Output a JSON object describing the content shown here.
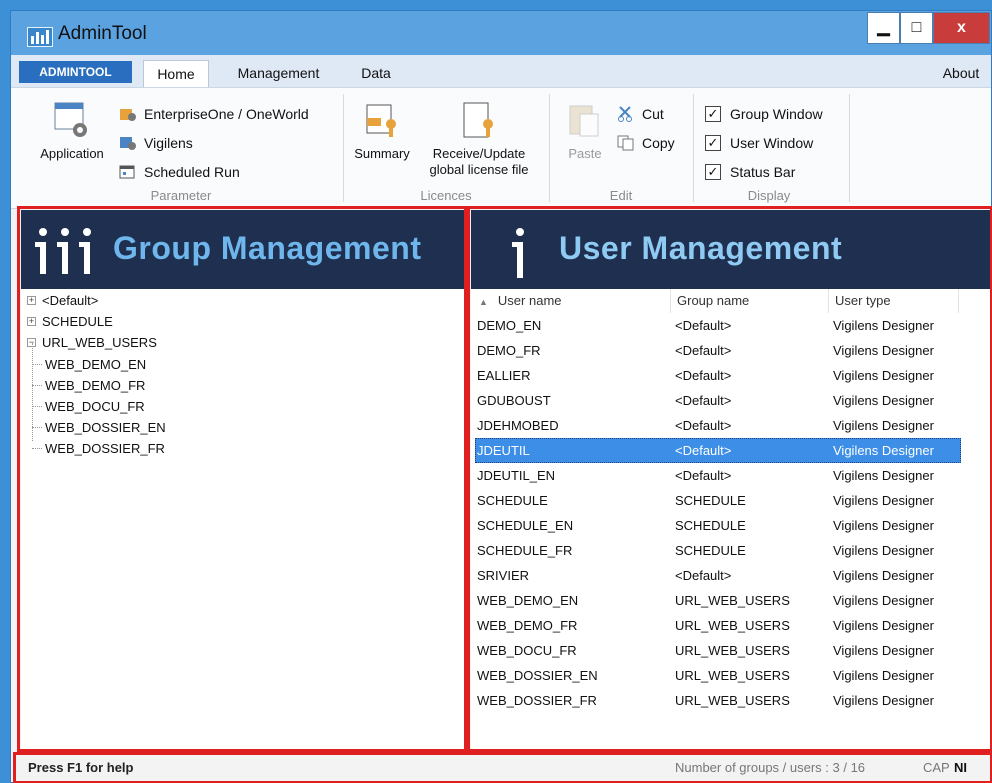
{
  "window": {
    "title": "AdminTool",
    "minimize": "▁",
    "maximize": "□",
    "close": "x"
  },
  "tabs": {
    "admin": "ADMINTOOL",
    "home": "Home",
    "management": "Management",
    "data": "Data",
    "about": "About"
  },
  "ribbon": {
    "parameter": {
      "label": "Parameter",
      "application": "Application",
      "enterprise": "EnterpriseOne / OneWorld",
      "vigilens": "Vigilens",
      "scheduled": "Scheduled Run"
    },
    "licences": {
      "label": "Licences",
      "summary": "Summary",
      "receive_line1": "Receive/Update",
      "receive_line2": "global license file"
    },
    "edit": {
      "label": "Edit",
      "paste": "Paste",
      "cut": "Cut",
      "copy": "Copy"
    },
    "display": {
      "label": "Display",
      "group_window": "Group Window",
      "user_window": "User Window",
      "status_bar": "Status Bar",
      "check": "✓"
    }
  },
  "group_panel": {
    "title": "Group Management",
    "tree": [
      {
        "label": "<Default>",
        "expander": "+"
      },
      {
        "label": "SCHEDULE",
        "expander": "+"
      },
      {
        "label": "URL_WEB_USERS",
        "expander": "−"
      },
      {
        "label": "WEB_DEMO_EN"
      },
      {
        "label": "WEB_DEMO_FR"
      },
      {
        "label": "WEB_DOCU_FR"
      },
      {
        "label": "WEB_DOSSIER_EN"
      },
      {
        "label": "WEB_DOSSIER_FR"
      }
    ]
  },
  "user_panel": {
    "title": "User Management",
    "sort_indicator": "▲",
    "columns": {
      "user": "User name",
      "group": "Group name",
      "type": "User type"
    },
    "rows": [
      {
        "user": "DEMO_EN",
        "group": "<Default>",
        "type": "Vigilens Designer"
      },
      {
        "user": "DEMO_FR",
        "group": "<Default>",
        "type": "Vigilens Designer"
      },
      {
        "user": "EALLIER",
        "group": "<Default>",
        "type": "Vigilens Designer"
      },
      {
        "user": "GDUBOUST",
        "group": "<Default>",
        "type": "Vigilens Designer"
      },
      {
        "user": "JDEHMOBED",
        "group": "<Default>",
        "type": "Vigilens Designer"
      },
      {
        "user": "JDEUTIL",
        "group": "<Default>",
        "type": "Vigilens Designer"
      },
      {
        "user": "JDEUTIL_EN",
        "group": "<Default>",
        "type": "Vigilens Designer"
      },
      {
        "user": "SCHEDULE",
        "group": "SCHEDULE",
        "type": "Vigilens Designer"
      },
      {
        "user": "SCHEDULE_EN",
        "group": "SCHEDULE",
        "type": "Vigilens Designer"
      },
      {
        "user": "SCHEDULE_FR",
        "group": "SCHEDULE",
        "type": "Vigilens Designer"
      },
      {
        "user": "SRIVIER",
        "group": "<Default>",
        "type": "Vigilens Designer"
      },
      {
        "user": "WEB_DEMO_EN",
        "group": "URL_WEB_USERS",
        "type": "Vigilens Designer"
      },
      {
        "user": "WEB_DEMO_FR",
        "group": "URL_WEB_USERS",
        "type": "Vigilens Designer"
      },
      {
        "user": "WEB_DOCU_FR",
        "group": "URL_WEB_USERS",
        "type": "Vigilens Designer"
      },
      {
        "user": "WEB_DOSSIER_EN",
        "group": "URL_WEB_USERS",
        "type": "Vigilens Designer"
      },
      {
        "user": "WEB_DOSSIER_FR",
        "group": "URL_WEB_USERS",
        "type": "Vigilens Designer"
      }
    ],
    "selected_row": "JDEUTIL"
  },
  "status": {
    "help": "Press F1 for help",
    "count": "Number of groups / users : 3 / 16",
    "cap": "CAP",
    "num": "NI"
  },
  "colors": {
    "accent": "#3c8ee6",
    "banner": "#1e2f4f",
    "highlight_frame": "#e02020",
    "close": "#c93c3c"
  },
  "icons": {
    "app": "admintool-logo-icon",
    "application": "application-settings-icon",
    "enterprise": "enterprise-icon",
    "vigilens": "vigilens-icon",
    "scheduled": "scheduled-run-icon",
    "summary": "license-summary-icon",
    "receive": "license-file-icon",
    "paste": "paste-icon",
    "cut": "scissors-icon",
    "copy": "copy-icon"
  }
}
